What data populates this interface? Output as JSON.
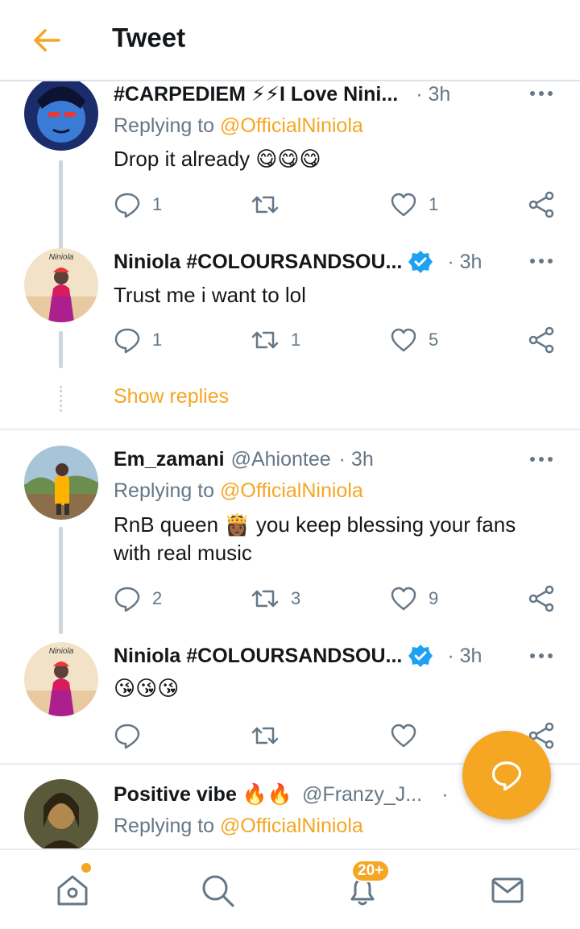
{
  "header": {
    "title": "Tweet",
    "back_icon": "arrow-left-icon"
  },
  "colors": {
    "accent": "#f5a623",
    "muted": "#657786",
    "text": "#14171a",
    "verified": "#1da1f2"
  },
  "tweets": [
    {
      "name": "#CARPEDIEM ⚡⚡I Love Nini...",
      "handle": "",
      "time": "· 3h",
      "replying_label": "Replying to",
      "replying_to": "@OfficialNiniola",
      "text": "Drop it already 😋😋😋",
      "replies": "1",
      "retweets": "",
      "likes": "1"
    },
    {
      "name": "Niniola #COLOURSANDSOU...",
      "verified": true,
      "time": "· 3h",
      "text": "Trust me i want to lol",
      "replies": "1",
      "retweets": "1",
      "likes": "5"
    },
    {
      "name": "Em_zamani",
      "handle": "@Ahiontee",
      "time": "· 3h",
      "replying_label": "Replying to",
      "replying_to": "@OfficialNiniola",
      "text": "RnB queen 👸🏾 you keep blessing your fans with real music",
      "replies": "2",
      "retweets": "3",
      "likes": "9"
    },
    {
      "name": "Niniola #COLOURSANDSOU...",
      "verified": true,
      "time": "· 3h",
      "text": "😘😘😘",
      "replies": "",
      "retweets": "",
      "likes": ""
    },
    {
      "name": "Positive vibe 🔥🔥",
      "handle": "@Franzy_J...",
      "time": "·",
      "replying_label": "Replying to",
      "replying_to": "@OfficialNiniola"
    }
  ],
  "show_replies": "Show replies",
  "nav": {
    "notifications_badge": "20+"
  }
}
